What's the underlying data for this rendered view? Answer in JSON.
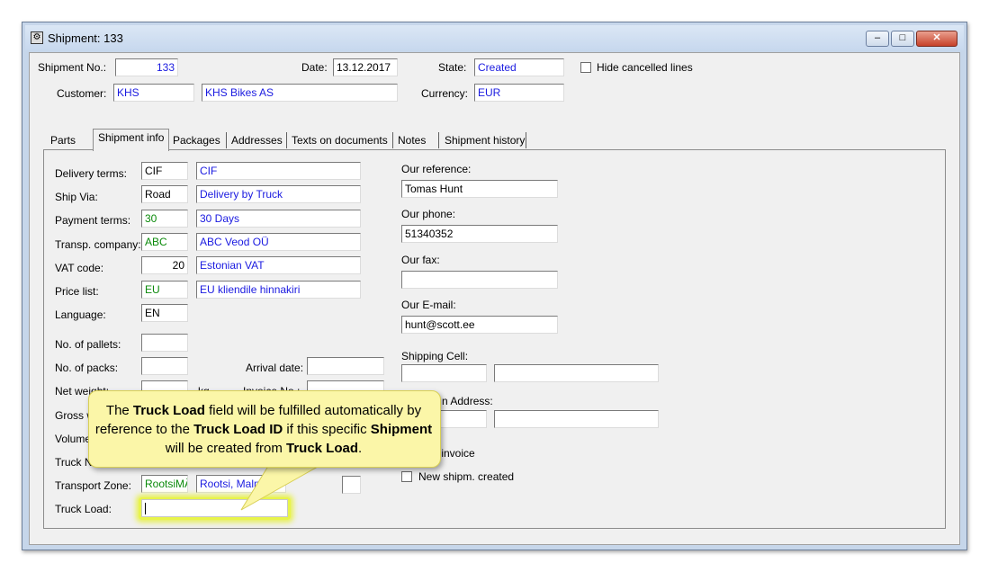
{
  "window": {
    "title": "Shipment: 133",
    "minimize": "–",
    "maximize": "□",
    "close": "✕"
  },
  "header": {
    "shipment_no_label": "Shipment No.:",
    "shipment_no": "133",
    "date_label": "Date:",
    "date": "13.12.2017",
    "state_label": "State:",
    "state": "Created",
    "hide_cancelled_label": "Hide cancelled lines",
    "customer_label": "Customer:",
    "customer_code": "KHS",
    "customer_name": "KHS Bikes AS",
    "currency_label": "Currency:",
    "currency": "EUR"
  },
  "tabs": [
    "Parts",
    "Shipment info",
    "Packages",
    "Addresses",
    "Texts on documents",
    "Notes",
    "Shipment history"
  ],
  "left": {
    "delivery_terms_label": "Delivery terms:",
    "delivery_terms_code": "CIF",
    "delivery_terms_name": "CIF",
    "ship_via_label": "Ship Via:",
    "ship_via_code": "Road",
    "ship_via_name": "Delivery by Truck",
    "payment_terms_label": "Payment terms:",
    "payment_terms_code": "30",
    "payment_terms_name": "30 Days",
    "transp_company_label": "Transp. company:",
    "transp_company_code": "ABC",
    "transp_company_name": "ABC Veod OÜ",
    "vat_code_label": "VAT code:",
    "vat_code": "20",
    "vat_name": "Estonian VAT",
    "price_list_label": "Price list:",
    "price_list_code": "EU",
    "price_list_name": "EU kliendile hinnakiri",
    "language_label": "Language:",
    "language": "EN",
    "pallets_label": "No. of pallets:",
    "packs_label": "No. of packs:",
    "net_weight_label": "Net weight:",
    "kg_label": "kg",
    "gross_label": "Gross w",
    "volume_label": "Volume:",
    "truck_no_label": "Truck N",
    "transport_zone_label": "Transport Zone:",
    "transport_zone_code": "RootsiMÄ",
    "transport_zone_name": "Rootsi, Malmö",
    "truck_load_label": "Truck Load:",
    "arrival_date_label": "Arrival date:",
    "invoice_no_label": "Invoice No.:"
  },
  "right": {
    "our_reference_label": "Our reference:",
    "our_reference": "Tomas Hunt",
    "our_phone_label": "Our phone:",
    "our_phone": "51340352",
    "our_fax_label": "Our fax:",
    "our_email_label": "Our E-mail:",
    "our_email": "hunt@scott.ee",
    "shipping_cell_label": "Shipping Cell:",
    "address_label": "n Address:",
    "create_invoice_label": "te invoice",
    "new_shipm_label": "New shipm. created"
  },
  "callout": {
    "t1": "The ",
    "b1": "Truck Load",
    "t2": " field will be fulfilled automatically by reference to the ",
    "b2": "Truck Load ID",
    "t3": " if this specific ",
    "b3": "Shipment",
    "t4": " will be created from ",
    "b4": "Truck Load",
    "t5": "."
  },
  "colors": {
    "field_text_blue": "#1a1ae0",
    "field_text_green": "#0a8a0a",
    "callout_bg": "#fbf6a8",
    "window_frame": "#c6d6ea"
  }
}
